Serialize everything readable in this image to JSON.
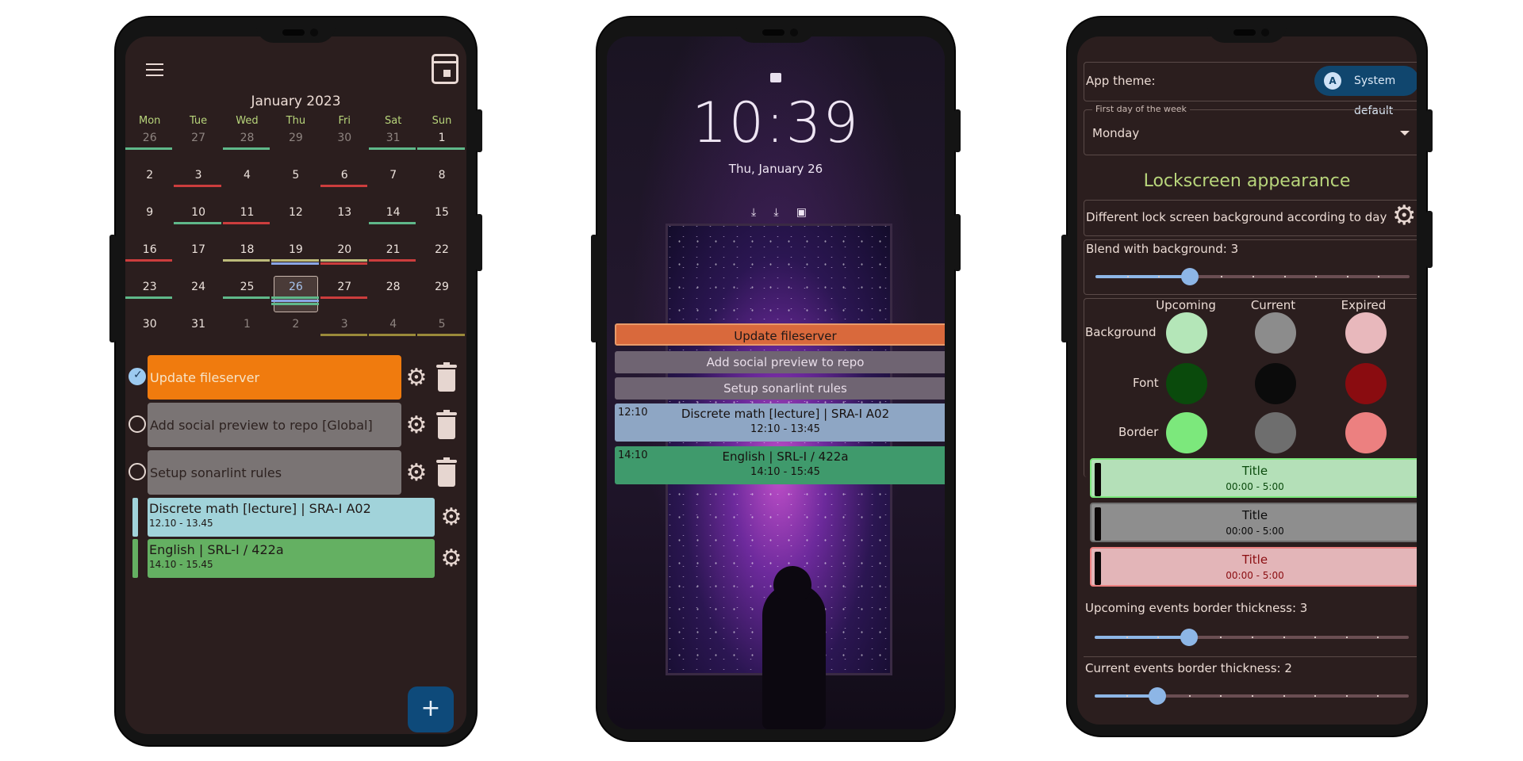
{
  "phone1": {
    "calendar": {
      "month_title": "January 2023",
      "weekdays": [
        "Mon",
        "Tue",
        "Wed",
        "Thu",
        "Fri",
        "Sat",
        "Sun"
      ],
      "weeks": [
        [
          "26",
          "27",
          "28",
          "29",
          "30",
          "31",
          "1"
        ],
        [
          "2",
          "3",
          "4",
          "5",
          "6",
          "7",
          "8"
        ],
        [
          "9",
          "10",
          "11",
          "12",
          "13",
          "14",
          "15"
        ],
        [
          "16",
          "17",
          "18",
          "19",
          "20",
          "21",
          "22"
        ],
        [
          "23",
          "24",
          "25",
          "26",
          "27",
          "28",
          "29"
        ],
        [
          "30",
          "31",
          "1",
          "2",
          "3",
          "4",
          "5"
        ]
      ]
    },
    "tasks": [
      {
        "label": "Update fileserver",
        "checked": true,
        "color": "#f07b0e"
      },
      {
        "label": "Add social preview to repo [Global]",
        "checked": false,
        "color": "#7a7474"
      },
      {
        "label": "Setup sonarlint rules",
        "checked": false,
        "color": "#7a7474"
      }
    ],
    "events": [
      {
        "title": "Discrete math [lecture] | SRA-I A02",
        "time": "12.10 - 13.45",
        "color": "#a1d3da"
      },
      {
        "title": "English | SRL-I / 422a",
        "time": "14.10 - 15.45",
        "color": "#64b062"
      }
    ],
    "fab_label": "+"
  },
  "phone2": {
    "clock": "10:39",
    "date": "Thu, January 26",
    "quick_icons": [
      "⤓",
      "⤓",
      "▣"
    ],
    "tasks": [
      {
        "label": "Update fileserver",
        "color": "#d9693c"
      },
      {
        "label": "Add social preview to repo",
        "color": "#6f6472"
      },
      {
        "label": "Setup sonarlint rules",
        "color": "#6f6472"
      }
    ],
    "events": [
      {
        "start": "12:10",
        "title": "Discrete math [lecture] | SRA-I A02",
        "time": "12:10 - 13:45",
        "color": "#8ea6c4"
      },
      {
        "start": "14:10",
        "title": "English | SRL-I / 422a",
        "time": "14:10 - 15:45",
        "color": "#3f9a6c"
      }
    ]
  },
  "phone3": {
    "app_theme_label": "App theme:",
    "theme_value": "System default",
    "theme_icon": "A",
    "first_day_legend": "First day of the week",
    "first_day_value": "Monday",
    "section_title": "Lockscreen appearance",
    "different_bg_label": "Different lock screen background according to day",
    "blend_label": "Blend with background: 3",
    "columns": [
      "Upcoming",
      "Current",
      "Expired"
    ],
    "rows": [
      {
        "label": "Background",
        "colors": [
          "#b4e6b8",
          "#8c8c8c",
          "#e8b8bc"
        ]
      },
      {
        "label": "Font",
        "colors": [
          "#0a4a0c",
          "#0b0b0b",
          "#8a0c10"
        ]
      },
      {
        "label": "Border",
        "colors": [
          "#7ce87c",
          "#6e6e6e",
          "#ec8080"
        ]
      }
    ],
    "previews": [
      {
        "title": "Title",
        "time": "00:00 - 5:00",
        "bg": "#b4e0b8",
        "border": "#7ce87c",
        "font": "#0a4a0c"
      },
      {
        "title": "Title",
        "time": "00:00 - 5:00",
        "bg": "#8e8e8e",
        "border": "#6e6e6e",
        "font": "#0b0b0b"
      },
      {
        "title": "Title",
        "time": "00:00 - 5:00",
        "bg": "#e3b5b8",
        "border": "#ec8080",
        "font": "#8a0c10"
      }
    ],
    "upcoming_border_label": "Upcoming events border thickness: 3",
    "current_border_label": "Current events border thickness: 2",
    "sliders": {
      "blend": 3,
      "upcoming_border": 3,
      "current_border": 2,
      "max": 10
    }
  }
}
